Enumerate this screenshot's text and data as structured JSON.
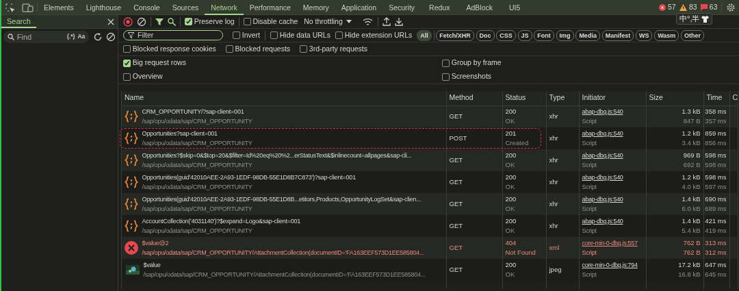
{
  "top_tabs": [
    {
      "label": "Elements",
      "selected": false
    },
    {
      "label": "Lighthouse",
      "selected": false
    },
    {
      "label": "Console",
      "selected": false
    },
    {
      "label": "Sources",
      "selected": false
    },
    {
      "label": "Network",
      "selected": true
    },
    {
      "label": "Performance",
      "selected": false
    },
    {
      "label": "Memory",
      "selected": false
    },
    {
      "label": "Application",
      "selected": false
    },
    {
      "label": "Security",
      "selected": false
    },
    {
      "label": "Redux",
      "selected": false
    },
    {
      "label": "AdBlock",
      "selected": false
    },
    {
      "label": "UI5",
      "selected": false
    }
  ],
  "console_counts": {
    "errors": "57",
    "warnings": "83",
    "messages": "63"
  },
  "ime_indicator": "中°,半",
  "search_panel": {
    "title": "Search",
    "find": {
      "placeholder": "Find"
    },
    "regex_toggle": "(.*)",
    "case_toggle": "Aa"
  },
  "toolbar": {
    "recording": true,
    "preserve_log": {
      "label": "Preserve log",
      "checked": true
    },
    "disable_cache": {
      "label": "Disable cache",
      "checked": false
    },
    "throttling": "No throttling"
  },
  "filter": {
    "placeholder": "Filter",
    "options": [
      {
        "label": "Invert",
        "checked": false
      },
      {
        "label": "Hide data URLs",
        "checked": false
      },
      {
        "label": "Hide extension URLs",
        "checked": false
      }
    ],
    "types": [
      {
        "label": "All",
        "selected": true
      },
      {
        "label": "Fetch/XHR",
        "selected": false
      },
      {
        "label": "Doc",
        "selected": false
      },
      {
        "label": "CSS",
        "selected": false
      },
      {
        "label": "JS",
        "selected": false
      },
      {
        "label": "Font",
        "selected": false
      },
      {
        "label": "Img",
        "selected": false
      },
      {
        "label": "Media",
        "selected": false
      },
      {
        "label": "Manifest",
        "selected": false
      },
      {
        "label": "WS",
        "selected": false
      },
      {
        "label": "Wasm",
        "selected": false
      },
      {
        "label": "Other",
        "selected": false
      }
    ]
  },
  "blocked_options": [
    {
      "label": "Blocked response cookies",
      "checked": false
    },
    {
      "label": "Blocked requests",
      "checked": false
    },
    {
      "label": "3rd-party requests",
      "checked": false
    }
  ],
  "settings": [
    {
      "label": "Big request rows",
      "checked": true
    },
    {
      "label": "Group by frame",
      "checked": false
    },
    {
      "label": "Overview",
      "checked": false
    },
    {
      "label": "Screenshots",
      "checked": false
    }
  ],
  "table": {
    "columns": [
      "Name",
      "Method",
      "Status",
      "Type",
      "Initiator",
      "Size",
      "Time",
      "C"
    ],
    "rows": [
      {
        "kind": "fetch",
        "name": "CRM_OPPORTUNITY/?sap-client=001",
        "path": "/sap/opu/odata/sap/CRM_OPPORTUNITY",
        "method": "GET",
        "status": "200",
        "status_text": "OK",
        "type": "xhr",
        "initiator": "abap-dbg.js:540",
        "initiator_type": "Script",
        "size": "1.3 kB",
        "resource_size": "847 B",
        "time": "358 ms",
        "latency": "357 ms",
        "failed": false,
        "annotated": false
      },
      {
        "kind": "fetch",
        "name": "Opportunities?sap-client=001",
        "path": "/sap/opu/odata/sap/CRM_OPPORTUNITY",
        "method": "POST",
        "status": "201",
        "status_text": "Created",
        "type": "xhr",
        "initiator": "abap-dbg.js:540",
        "initiator_type": "Script",
        "size": "1.2 kB",
        "resource_size": "3.4 kB",
        "time": "859 ms",
        "latency": "856 ms",
        "failed": false,
        "annotated": true
      },
      {
        "kind": "fetch",
        "name": "Opportunities?$skip=0&$top=20&$filter=Id%20eq%20%2...erStatusText&$inlinecount=allpages&sap-cli...",
        "path": "/sap/opu/odata/sap/CRM_OPPORTUNITY",
        "method": "GET",
        "status": "200",
        "status_text": "OK",
        "type": "xhr",
        "initiator": "abap-dbg.js:540",
        "initiator_type": "Script",
        "size": "969 B",
        "resource_size": "692 B",
        "time": "598 ms",
        "latency": "598 ms",
        "failed": false,
        "annotated": false
      },
      {
        "kind": "fetch",
        "name": "Opportunities(guid'42010AEE-2A93-1EDF-98DB-55E1D8B7C873')?sap-client=001",
        "path": "/sap/opu/odata/sap/CRM_OPPORTUNITY",
        "method": "GET",
        "status": "200",
        "status_text": "OK",
        "type": "xhr",
        "initiator": "abap-dbg.js:540",
        "initiator_type": "Script",
        "size": "1.2 kB",
        "resource_size": "4.0 kB",
        "time": "598 ms",
        "latency": "597 ms",
        "failed": false,
        "annotated": false
      },
      {
        "kind": "fetch",
        "name": "Opportunities(guid'42010AEE-2A93-1EDF-98DB-55E1D8B...etitors,Products,OpportunityLogSet&sap-clien...",
        "path": "/sap/opu/odata/sap/CRM_OPPORTUNITY",
        "method": "GET",
        "status": "200",
        "status_text": "OK",
        "type": "xhr",
        "initiator": "abap-dbg.js:540",
        "initiator_type": "Script",
        "size": "1.4 kB",
        "resource_size": "6.0 kB",
        "time": "690 ms",
        "latency": "689 ms",
        "failed": false,
        "annotated": false
      },
      {
        "kind": "fetch",
        "name": "AccountCollection('4031140')?$expand=Logo&sap-client=001",
        "path": "/sap/opu/odata/sap/CRM_OPPORTUNITY",
        "method": "GET",
        "status": "200",
        "status_text": "OK",
        "type": "xhr",
        "initiator": "abap-dbg.js:540",
        "initiator_type": "Script",
        "size": "1.4 kB",
        "resource_size": "5.4 kB",
        "time": "421 ms",
        "latency": "419 ms",
        "failed": false,
        "annotated": false
      },
      {
        "kind": "error",
        "name": "$value@2",
        "path": "/sap/opu/odata/sap/CRM_OPPORTUNITY/AttachmentCollection(documentID='FA163EEF573D1EE585804...",
        "method": "GET",
        "status": "404",
        "status_text": "Not Found",
        "type": "xml",
        "initiator": "core-min-0-dbg.js:557",
        "initiator_type": "Script",
        "size": "762 B",
        "resource_size": "762 B",
        "time": "313 ms",
        "latency": "312 ms",
        "failed": true,
        "annotated": false
      },
      {
        "name": "$value",
        "path": "/sap/opu/odata/sap/CRM_OPPORTUNITY/AttachmentCollection(documentID='FA163EEF573D1EE585804...",
        "method": "GET",
        "status": "200",
        "status_text": "OK",
        "type": "jpeg",
        "initiator": "core-min-0-dbg.js:794",
        "initiator_type": "Script",
        "size": "17.2 kB",
        "resource_size": "16.8 kB",
        "time": "647 ms",
        "latency": "645 ms",
        "failed": false,
        "annotated": false
      }
    ]
  }
}
